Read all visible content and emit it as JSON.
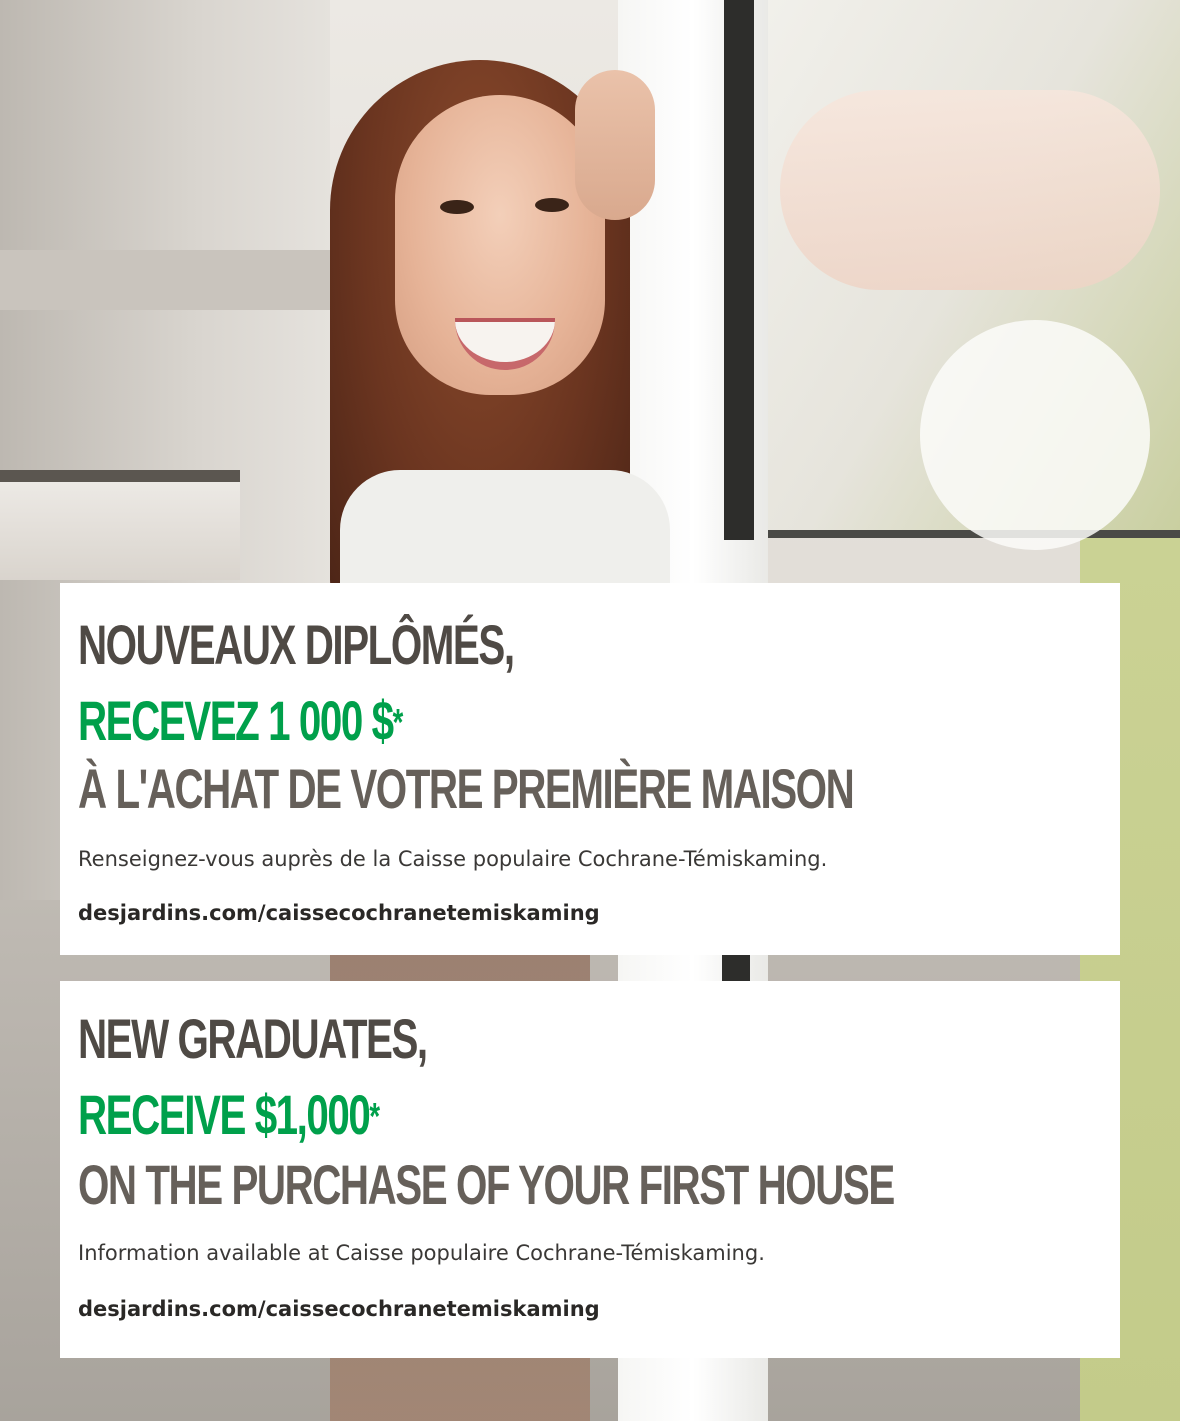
{
  "french": {
    "headline_line1": "NOUVEAUX DIPLÔMÉS,",
    "headline_line2": "RECEVEZ 1 000 $",
    "headline_line2_mark": "*",
    "headline_line3": "À L'ACHAT DE VOTRE PREMIÈRE MAISON",
    "body": "Renseignez-vous auprès de la Caisse populaire Cochrane-Témiskaming.",
    "url": "desjardins.com/caissecochranetemiskaming"
  },
  "english": {
    "headline_line1": "NEW GRADUATES,",
    "headline_line2": "RECEIVE $1,000",
    "headline_line2_mark": "*",
    "headline_line3": "ON THE PURCHASE OF YOUR FIRST HOUSE",
    "body": "Information available at Caisse populaire Cochrane-Témiskaming.",
    "url": "desjardins.com/caissecochranetemiskaming"
  },
  "colors": {
    "headline_dark": "#4f4a45",
    "accent_green": "#00a04b",
    "panel_background": "#ffffff"
  }
}
